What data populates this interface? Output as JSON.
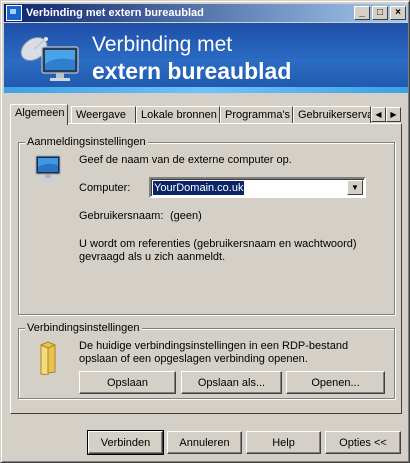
{
  "window": {
    "title": "Verbinding met extern bureaublad",
    "controls": {
      "minimize": "_",
      "maximize": "□",
      "close": "×"
    }
  },
  "banner": {
    "line1": "Verbinding met",
    "line2": "extern bureaublad"
  },
  "tabs": [
    {
      "label": "Algemeen",
      "active": true
    },
    {
      "label": "Weergave",
      "active": false
    },
    {
      "label": "Lokale bronnen",
      "active": false
    },
    {
      "label": "Programma's",
      "active": false
    },
    {
      "label": "Gebruikerserva",
      "active": false
    }
  ],
  "tab_scroll": {
    "left": "◀",
    "right": "▶"
  },
  "logon": {
    "group_label": "Aanmeldingsinstellingen",
    "instruction": "Geef de naam van de externe computer op.",
    "computer_label": "Computer:",
    "computer_value": "YourDomain.co.uk",
    "username_label": "Gebruikersnaam:",
    "username_value": "(geen)",
    "credentials_text_1": "U wordt om referenties (gebruikersnaam en wachtwoord)",
    "credentials_text_2": "gevraagd als u zich aanmeldt."
  },
  "connection": {
    "group_label": "Verbindingsinstellingen",
    "text_1": "De huidige verbindingsinstellingen in een RDP-bestand",
    "text_2": "opslaan of een opgeslagen verbinding openen.",
    "save_label": "Opslaan",
    "save_as_label": "Opslaan als...",
    "open_label": "Openen..."
  },
  "footer": {
    "connect_label": "Verbinden",
    "cancel_label": "Annuleren",
    "help_label": "Help",
    "options_label": "Opties <<"
  },
  "icons": {
    "app": "remote-desktop-icon",
    "banner": "computer-satellite-icon",
    "computer": "computer-icon",
    "folder": "folder-icon"
  },
  "colors": {
    "titlebar_start": "#0a246a",
    "titlebar_end": "#a6caf0",
    "banner": "#2b6cc4",
    "selection": "#0a246a",
    "face": "#d4d0c8"
  }
}
